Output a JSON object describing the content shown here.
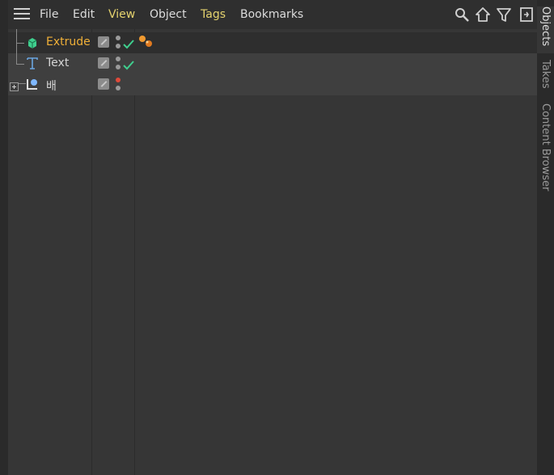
{
  "menu": {
    "items": [
      {
        "label": "File",
        "accent": false
      },
      {
        "label": "Edit",
        "accent": false
      },
      {
        "label": "View",
        "accent": true
      },
      {
        "label": "Object",
        "accent": false
      },
      {
        "label": "Tags",
        "accent": true
      },
      {
        "label": "Bookmarks",
        "accent": false
      }
    ],
    "toolbar_icons": [
      "search-icon",
      "home-icon",
      "filter-icon",
      "new-panel-icon"
    ]
  },
  "objects": [
    {
      "name": "Extrude",
      "icon": "extrude-icon",
      "selected": true,
      "visibility": "default",
      "enabled": true,
      "tags": [
        "phong-tag"
      ]
    },
    {
      "name": "Text",
      "icon": "text-icon",
      "selected": false,
      "visibility": "default",
      "enabled": true,
      "tags": []
    },
    {
      "name": "배",
      "icon": "mesh-icon",
      "selected": false,
      "visibility": "hidden-red",
      "enabled": null,
      "tags": [],
      "collapsed": true
    }
  ],
  "rail": {
    "tabs": [
      {
        "label": "Objects",
        "active": true
      },
      {
        "label": "Takes",
        "active": false
      },
      {
        "label": "Content Browser",
        "active": false
      }
    ]
  },
  "colors": {
    "accent_menu": "#e5d36e",
    "selected_object": "#f0b038",
    "check_green": "#3fcf8e",
    "visibility_red": "#e04a3a"
  }
}
